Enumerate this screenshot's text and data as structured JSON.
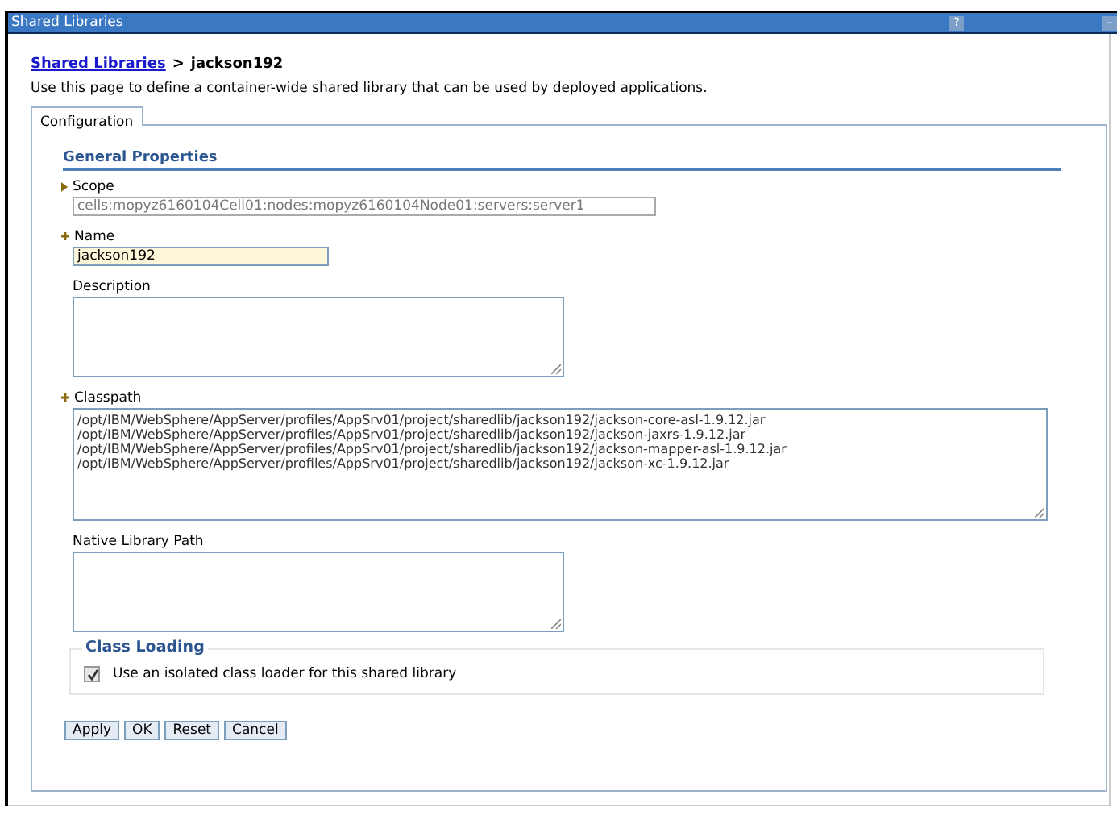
{
  "window": {
    "title": "Shared Libraries",
    "help": "?",
    "minimize": "–"
  },
  "breadcrumb": {
    "link": "Shared Libraries",
    "separator": ">",
    "current": "jackson192"
  },
  "description": "Use this page to define a container-wide shared library that can be used by deployed applications.",
  "tabs": [
    {
      "label": "Configuration",
      "selected": true
    }
  ],
  "section_title": "General Properties",
  "fields": [
    {
      "kind": "text",
      "label": "Scope",
      "expandable": true,
      "required": false,
      "value": "cells:mopyz6160104Cell01:nodes:mopyz6160104Node01:servers:server1",
      "disabled": true
    },
    {
      "kind": "text",
      "label": "Name",
      "required": true,
      "value": "jackson192",
      "disabled": false
    },
    {
      "kind": "area",
      "label": "Description",
      "required": false
    },
    {
      "kind": "area",
      "label": "Classpath",
      "required": true,
      "wide": true,
      "lines": [
        "/opt/IBM/WebSphere/AppServer/profiles/AppSrv01/project/sharedlib/jackson192/jackson-core-asl-1.9.12.jar",
        "/opt/IBM/WebSphere/AppServer/profiles/AppSrv01/project/sharedlib/jackson192/jackson-jaxrs-1.9.12.jar",
        "/opt/IBM/WebSphere/AppServer/profiles/AppSrv01/project/sharedlib/jackson192/jackson-mapper-asl-1.9.12.jar",
        "/opt/IBM/WebSphere/AppServer/profiles/AppSrv01/project/sharedlib/jackson192/jackson-xc-1.9.12.jar"
      ]
    },
    {
      "kind": "area",
      "label": "Native Library Path",
      "required": false
    }
  ],
  "class_loading": {
    "title": "Class Loading",
    "checkbox": {
      "label": "Use an isolated class loader for this shared library",
      "checked": true
    }
  },
  "buttons": [
    "Apply",
    "OK",
    "Reset",
    "Cancel"
  ]
}
